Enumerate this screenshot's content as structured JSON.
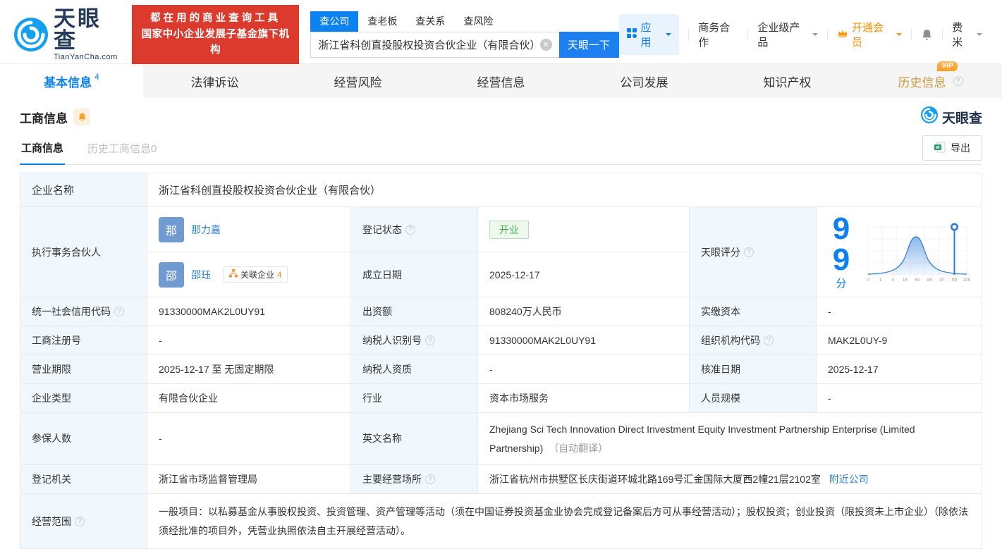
{
  "header": {
    "logo_title": "天眼查",
    "logo_domain": "TianYanCha.com",
    "promo_line1": "都在用的商业查询工具",
    "promo_line2": "国家中小企业发展子基金旗下机构",
    "search_tabs": [
      {
        "label": "查公司"
      },
      {
        "label": "查老板"
      },
      {
        "label": "查关系"
      },
      {
        "label": "查风险"
      }
    ],
    "search_value": "浙江省科创直投股权投资合伙企业（有限合伙）",
    "search_button": "天眼一下",
    "nav": {
      "apps": "应用",
      "cooperation": "商务合作",
      "enterprise": "企业级产品",
      "vip": "开通会员",
      "username": "费米"
    }
  },
  "tabs": [
    {
      "label": "基本信息",
      "count": "4"
    },
    {
      "label": "法律诉讼"
    },
    {
      "label": "经营风险"
    },
    {
      "label": "经营信息"
    },
    {
      "label": "公司发展"
    },
    {
      "label": "知识产权"
    },
    {
      "label": "历史信息",
      "vip_badge": "VIP"
    }
  ],
  "section": {
    "title": "工商信息",
    "watermark": "天眼查"
  },
  "card": {
    "subtab_active": "工商信息",
    "subtab_history": "历史工商信息",
    "subtab_history_count": "0",
    "export_label": "导出"
  },
  "biz": {
    "company_name": {
      "label": "企业名称",
      "value": "浙江省科创直投股权投资合伙企业（有限合伙）"
    },
    "partners": {
      "label": "执行事务合伙人",
      "items": [
        {
          "initial": "那",
          "name": "那力嘉"
        },
        {
          "initial": "邵",
          "name": "邵珏",
          "related_label": "关联企业",
          "related_count": "4"
        }
      ]
    },
    "reg_status": {
      "label": "登记状态",
      "value": "开业"
    },
    "est_date": {
      "label": "成立日期",
      "value": "2025-12-17"
    },
    "score_label": "天眼评分",
    "credit_code": {
      "label": "统一社会信用代码",
      "value": "91330000MAK2L0UY91"
    },
    "capital": {
      "label": "出资额",
      "value": "808240万人民币"
    },
    "paid_capital": {
      "label": "实缴资本",
      "value": "-"
    },
    "reg_number": {
      "label": "工商注册号",
      "value": "-"
    },
    "taxpayer_id": {
      "label": "纳税人识别号",
      "value": "91330000MAK2L0UY91"
    },
    "org_code": {
      "label": "组织机构代码",
      "value": "MAK2L0UY-9"
    },
    "business_term": {
      "label": "营业期限",
      "value": "2025-12-17 至 无固定期限"
    },
    "taxpayer_quality": {
      "label": "纳税人资质",
      "value": "-"
    },
    "approval_date": {
      "label": "核准日期",
      "value": "2025-12-17"
    },
    "company_type": {
      "label": "企业类型",
      "value": "有限合伙企业"
    },
    "industry": {
      "label": "行业",
      "value": "资本市场服务"
    },
    "staff_size": {
      "label": "人员规模",
      "value": "-"
    },
    "insured_count": {
      "label": "参保人数",
      "value": "-"
    },
    "english_name": {
      "label": "英文名称",
      "value": "Zhejiang Sci Tech Innovation Direct Investment Equity Investment Partnership Enterprise (Limited Partnership)",
      "note": "（自动翻译）"
    },
    "reg_authority": {
      "label": "登记机关",
      "value": "浙江省市场监督管理局"
    },
    "address": {
      "label": "主要经营场所",
      "value": "浙江省杭州市拱墅区长庆街道环城北路169号汇金国际大厦西2幢21层2102室",
      "link": "附近公司"
    },
    "scope": {
      "label": "经营范围",
      "value": "一般项目：以私募基金从事股权投资、投资管理、资产管理等活动（须在中国证券投资基金业协会完成登记备案后方可从事经营活动）；股权投资；创业投资（限投资未上市企业）（除依法须经批准的项目外，凭营业执照依法自主开展经营活动）。"
    }
  },
  "chart_data": {
    "type": "area",
    "title": "天眼评分",
    "score_value": "99",
    "score_unit": "分",
    "x_ticks": [
      "0",
      "1",
      "3",
      "15",
      "50",
      "85",
      "97",
      "99",
      "100"
    ],
    "marker_x": 99,
    "axis_range": [
      0,
      100
    ],
    "grid": true,
    "curve": "bell-shaped score percentile distribution, peak near tick 50, marker pin at company score 99"
  }
}
